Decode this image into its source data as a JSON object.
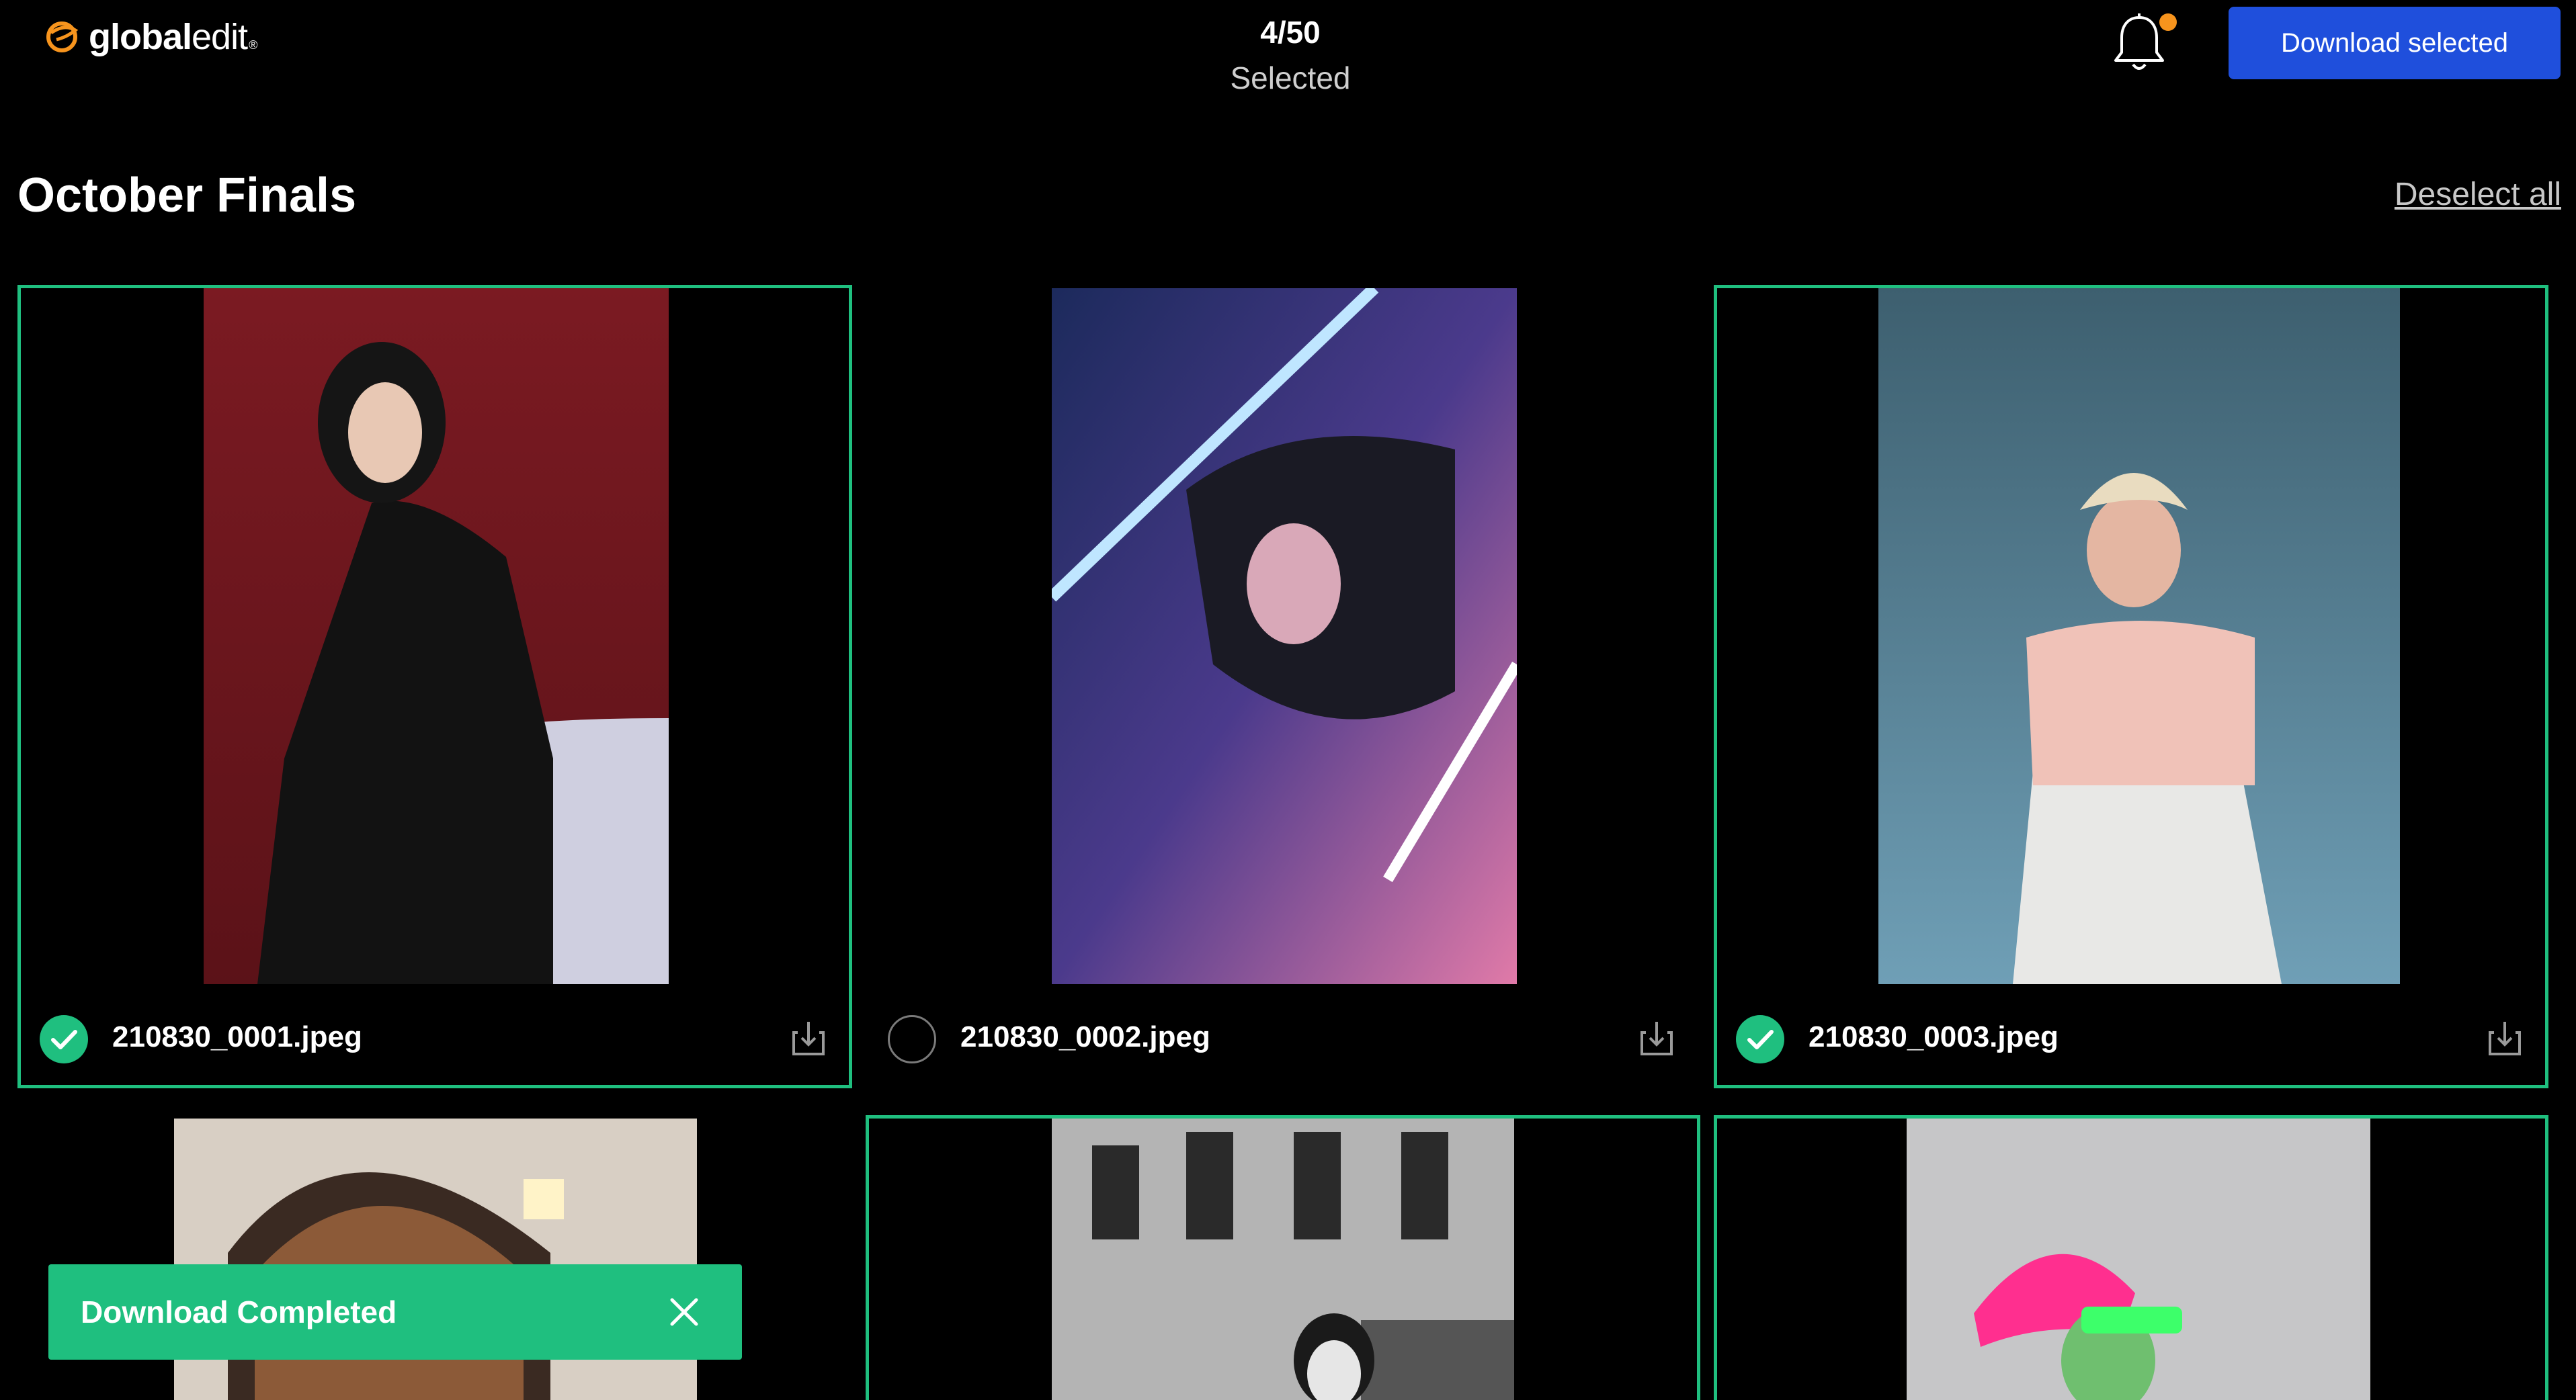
{
  "brand": {
    "name_bold": "global",
    "name_light": "edit",
    "mark": "®"
  },
  "selection": {
    "count": "4/50",
    "label": "Selected"
  },
  "header": {
    "download_selected_label": "Download selected",
    "notification_icon": "bell-icon",
    "notification_dot_color": "#f7941d"
  },
  "page": {
    "title": "October Finals",
    "deselect_all_label": "Deselect all"
  },
  "colors": {
    "accent_green": "#1fbf7f",
    "primary_blue": "#1f4fdc",
    "background": "#000000"
  },
  "images": [
    {
      "file": "210830_0001.jpeg",
      "selected": true
    },
    {
      "file": "210830_0002.jpeg",
      "selected": false
    },
    {
      "file": "210830_0003.jpeg",
      "selected": true
    },
    {
      "file": "",
      "selected": false
    },
    {
      "file": "",
      "selected": true
    },
    {
      "file": "",
      "selected": true
    }
  ],
  "toast": {
    "message": "Download Completed",
    "close_icon": "close-icon"
  }
}
